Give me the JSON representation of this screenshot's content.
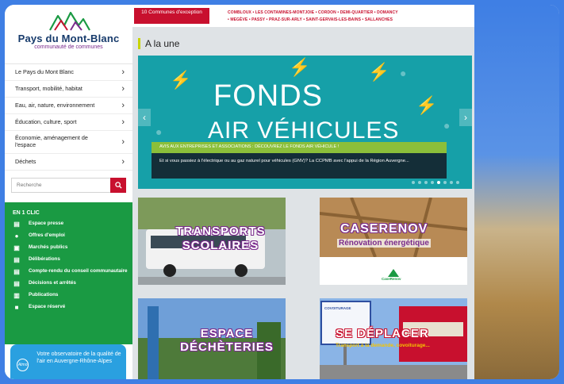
{
  "logo": {
    "title": "Pays du Mont-Blanc",
    "subtitle": "communauté de communes"
  },
  "nav": {
    "items": [
      {
        "label": "Le Pays du Mont Blanc"
      },
      {
        "label": "Transport, mobilité, habitat"
      },
      {
        "label": "Eau, air, nature, environnement"
      },
      {
        "label": "Éducation, culture, sport"
      },
      {
        "label": "Économie, aménagement de l'espace"
      },
      {
        "label": "Déchets"
      }
    ],
    "chevron": "›"
  },
  "search": {
    "placeholder": "Recherche",
    "icon": "search-icon"
  },
  "quick": {
    "title": "EN 1 CLIC",
    "items": [
      {
        "label": "Espace presse",
        "icon": "newspaper-icon"
      },
      {
        "label": "Offres d'emploi",
        "icon": "person-icon"
      },
      {
        "label": "Marchés publics",
        "icon": "document-icon"
      },
      {
        "label": "Délibérations",
        "icon": "document-icon"
      },
      {
        "label": "Compte-rendu du conseil communautaire",
        "icon": "document-icon"
      },
      {
        "label": "Décisions et arrêtés",
        "icon": "document-icon"
      },
      {
        "label": "Publications",
        "icon": "book-icon"
      },
      {
        "label": "Espace réservé",
        "icon": "lock-icon"
      }
    ]
  },
  "air": {
    "logo": "Atmo",
    "text": "Votre observatoire de la qualité de l'air en Auvergne-Rhône-Alpes"
  },
  "topbar": {
    "communes_button": "10 Communes d'exception",
    "communes_line1": "COMBLOUX • LES CONTAMINES-MONTJOIE • CORDON • DEMI-QUARTIER • DOMANCY",
    "communes_line2": "• MEGÈVE • PASSY • PRAZ-SUR-ARLY • SAINT-GERVAIS-LES-BAINS • SALLANCHES"
  },
  "main": {
    "section_title": "A la une",
    "slide": {
      "title_line1": "FONDS",
      "title_line2": "AIR VÉHICULES",
      "caption": "AVIS AUX ENTREPRISES ET ASSOCIATIONS : DÉCOUVREZ LE FONDS AIR VÉHICULE !",
      "description": "Et si vous passiez à l'électrique ou au gaz naturel pour véhicules (GNV)? La CCPMB avec l'appui de la Région Auvergne..."
    },
    "cards": [
      {
        "label": "TRANSPORTS SCOLAIRES"
      },
      {
        "label": "CASERENOV",
        "sublabel": "Rénovation énergétique",
        "logo": "CaseRenov"
      },
      {
        "label": "ESPACE DÉCHÈTERIES"
      },
      {
        "label": "SE DÉPLACER",
        "sublabel": "Transport à la demande, covoiturage...",
        "sign": "COVOITURAGE"
      }
    ]
  },
  "colors": {
    "brand_red": "#c8102e",
    "brand_green": "#1a9a43",
    "accent_lime": "#c8d400",
    "slide_teal": "#16a0a8",
    "card_outline": "#7a2b8c"
  }
}
